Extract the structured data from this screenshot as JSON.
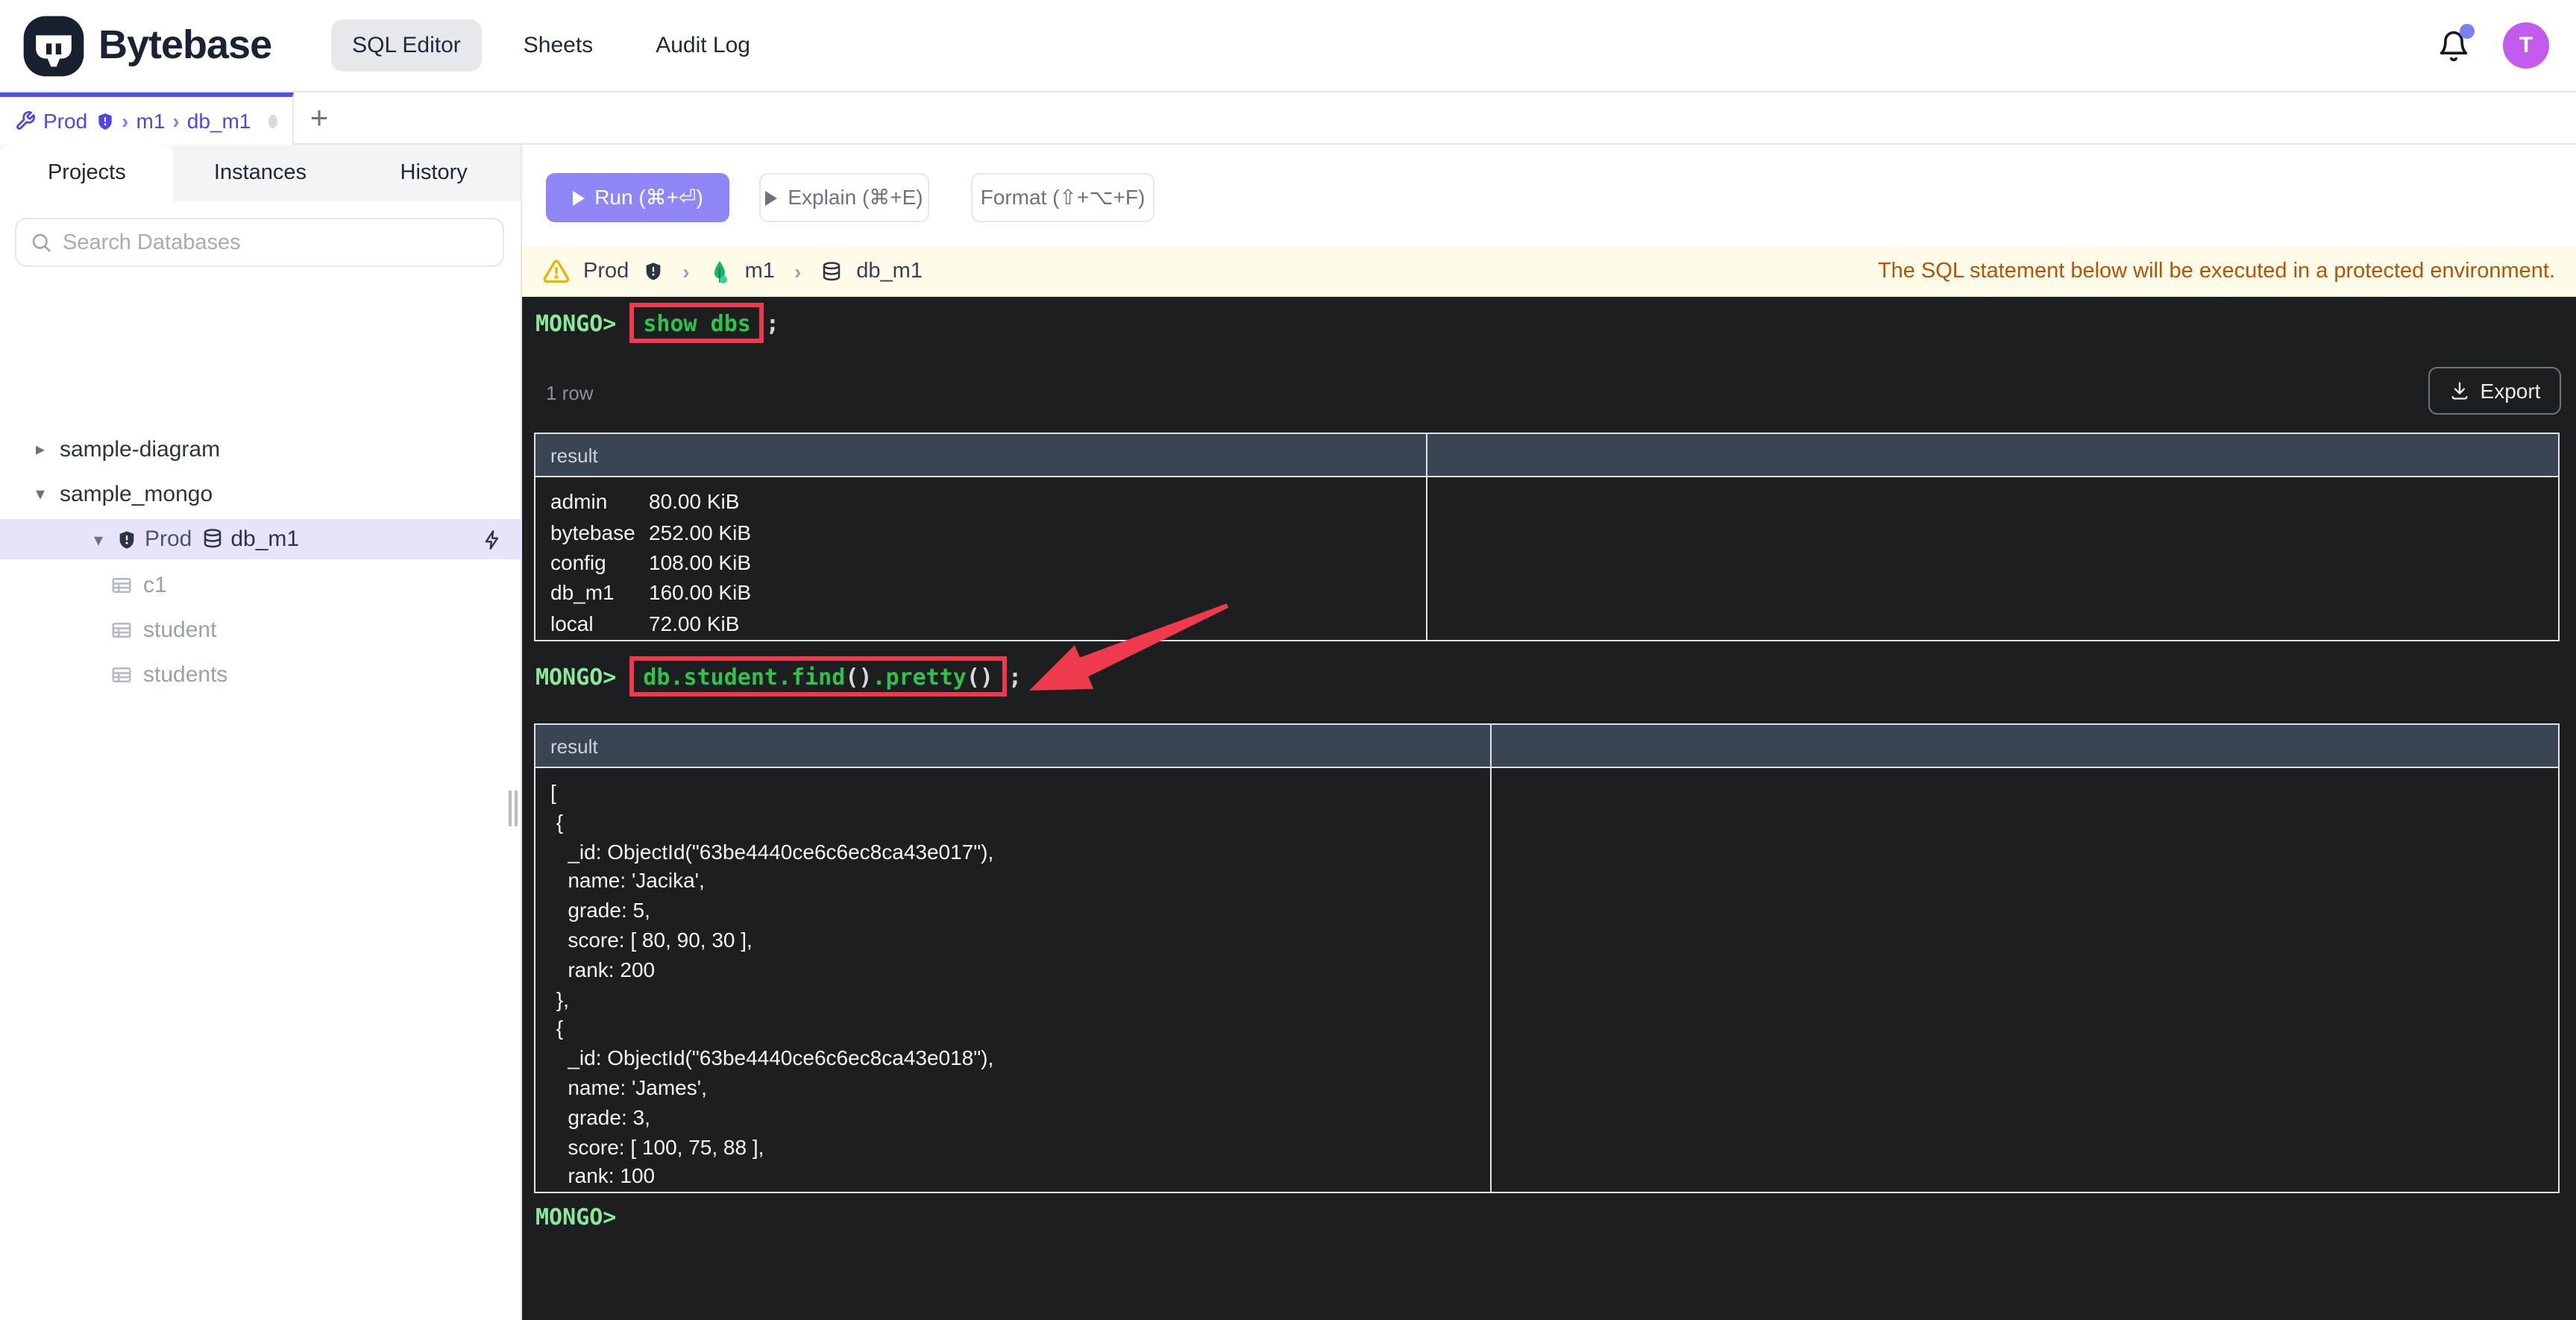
{
  "header": {
    "brand": "Bytebase",
    "nav": [
      {
        "label": "SQL Editor"
      },
      {
        "label": "Sheets"
      },
      {
        "label": "Audit Log"
      }
    ],
    "avatar_initial": "T"
  },
  "tabs": {
    "active": {
      "env": "Prod",
      "instance": "m1",
      "database": "db_m1"
    },
    "separator": "›",
    "new_tab": "+"
  },
  "sidebar": {
    "tabs": [
      {
        "label": "Projects"
      },
      {
        "label": "Instances"
      },
      {
        "label": "History"
      }
    ],
    "search_placeholder": "Search Databases",
    "tree": {
      "project1": "sample-diagram",
      "project2": "sample_mongo",
      "selected_env": "Prod",
      "selected_db": "db_m1",
      "collections": [
        {
          "name": "c1"
        },
        {
          "name": "student"
        },
        {
          "name": "students"
        }
      ]
    }
  },
  "toolbar": {
    "run": "Run (⌘+⏎)",
    "explain": "Explain (⌘+E)",
    "format": "Format (⇧+⌥+F)"
  },
  "banner": {
    "env": "Prod",
    "instance": "m1",
    "database": "db_m1",
    "separator": "›",
    "message": "The SQL statement below will be executed in a protected environment."
  },
  "terminal": {
    "prompt": "MONGO>",
    "command1": "show dbs",
    "command1_suffix": ";",
    "rows_label": "1 row",
    "export_label": "Export",
    "command2": {
      "seg1": "db.student.find",
      "seg2": "()",
      "seg3": ".pretty",
      "seg4": "()",
      "suffix": ";"
    },
    "bottom_prompt": "MONGO>"
  },
  "table1": {
    "header": "result",
    "rows": [
      {
        "name": "admin",
        "size": "80.00 KiB"
      },
      {
        "name": "bytebase",
        "size": "252.00 KiB"
      },
      {
        "name": "config",
        "size": "108.00 KiB"
      },
      {
        "name": "db_m1",
        "size": "160.00 KiB"
      },
      {
        "name": "local",
        "size": "72.00 KiB"
      }
    ]
  },
  "table2": {
    "header": "result",
    "body": "[\n {\n   _id: ObjectId(\"63be4440ce6c6ec8ca43e017\"),\n   name: 'Jacika',\n   grade: 5,\n   score: [ 80, 90, 30 ],\n   rank: 200\n },\n {\n   _id: ObjectId(\"63be4440ce6c6ec8ca43e018\"),\n   name: 'James',\n   grade: 3,\n   score: [ 100, 75, 88 ],\n   rank: 100"
  },
  "colors": {
    "accent_indigo": "#5551e8",
    "run_button": "#8f86f7",
    "annotation_red": "#ee3a4c",
    "prompt_green": "#8ce99a",
    "command_green": "#2fc24d",
    "warning_text": "#b45309",
    "table_header_bg": "#3a4553",
    "terminal_bg": "#1d1e1f",
    "avatar_purple": "#c45bef",
    "mongo_green": "#12b76a"
  }
}
